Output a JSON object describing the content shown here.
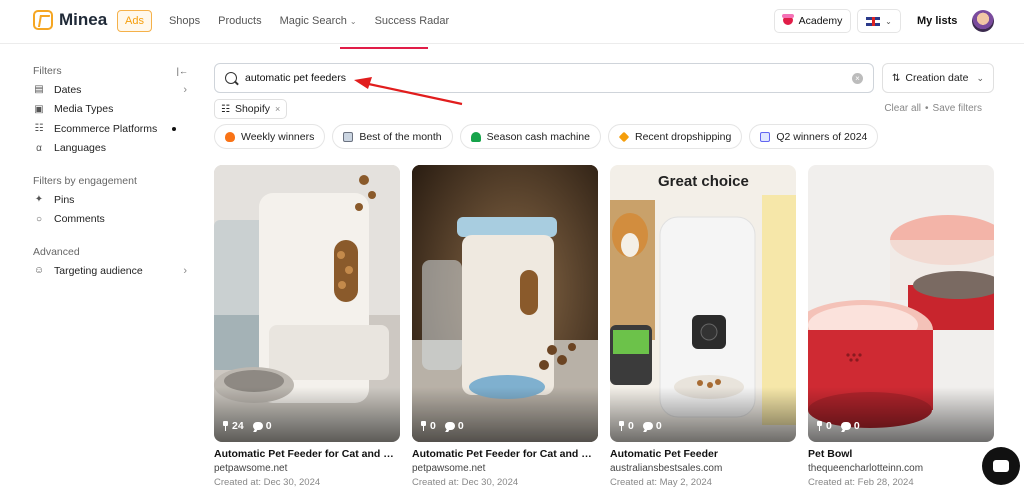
{
  "app": {
    "brand": "Minea",
    "nav": [
      {
        "label": "Ads",
        "active": true
      },
      {
        "label": "Shops"
      },
      {
        "label": "Products"
      },
      {
        "label": "Magic Search",
        "dropdown": true
      },
      {
        "label": "Success Radar"
      }
    ],
    "academy_label": "Academy",
    "language_flag": "uk-flag-icon",
    "mylists_label": "My lists"
  },
  "sidebar": {
    "filters_title": "Filters",
    "filters": [
      {
        "label": "Dates",
        "icon": "calendar-icon",
        "chevron": true
      },
      {
        "label": "Media Types",
        "icon": "video-icon"
      },
      {
        "label": "Ecommerce Platforms",
        "icon": "cart-icon",
        "active_dot": true
      },
      {
        "label": "Languages",
        "icon": "translate-icon"
      }
    ],
    "engagement_title": "Filters by engagement",
    "engagement": [
      {
        "label": "Pins",
        "icon": "pin-icon"
      },
      {
        "label": "Comments",
        "icon": "comment-icon"
      }
    ],
    "advanced_title": "Advanced",
    "advanced": [
      {
        "label": "Targeting audience",
        "icon": "user-icon",
        "chevron": true
      }
    ]
  },
  "search": {
    "value": "automatic pet feeders"
  },
  "sort": {
    "label": "Creation date"
  },
  "active_filters": {
    "chip_label": "Shopify",
    "clear_all": "Clear all",
    "separator": "•",
    "save_filters": "Save filters"
  },
  "quick_filters": [
    {
      "label": "Weekly winners",
      "icon": "fire-icon",
      "color": "#f97316"
    },
    {
      "label": "Best of the month",
      "icon": "chart-icon",
      "color": "#6b7280"
    },
    {
      "label": "Season cash machine",
      "icon": "palm-icon",
      "color": "#16a34a"
    },
    {
      "label": "Recent dropshipping",
      "icon": "sparkle-icon",
      "color": "#f59e0b"
    },
    {
      "label": "Q2 winners of 2024",
      "icon": "calendar-icon",
      "color": "#6366f1"
    }
  ],
  "cards": [
    {
      "pins": "24",
      "comments": "0",
      "title": "Automatic Pet Feeder for Cat and Do...",
      "domain": "petpawsome.net",
      "created": "Created at: Dec 30, 2024"
    },
    {
      "pins": "0",
      "comments": "0",
      "title": "Automatic Pet Feeder for Cat and Do...",
      "domain": "petpawsome.net",
      "created": "Created at: Dec 30, 2024"
    },
    {
      "pins": "0",
      "comments": "0",
      "title": "Automatic Pet Feeder",
      "domain": "australiansbestsales.com",
      "created": "Created at: May 2, 2024",
      "image_text": "Great choice"
    },
    {
      "pins": "0",
      "comments": "0",
      "title": "Pet Bowl",
      "domain": "thequeencharlotteinn.com",
      "created": "Created at: Feb 28, 2024"
    }
  ]
}
